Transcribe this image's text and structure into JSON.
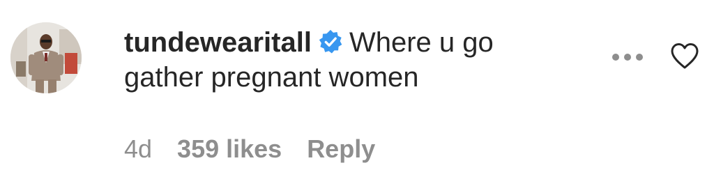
{
  "comment": {
    "username": "tundewearitall",
    "verified": true,
    "text_line1": "Where u go",
    "text_line2": "gather pregnant women",
    "time_ago": "4d",
    "likes": "359 likes",
    "reply_label": "Reply"
  },
  "icons": {
    "verified": "verified-badge-icon",
    "more": "more-options-icon",
    "like": "heart-outline-icon"
  },
  "colors": {
    "text": "#262626",
    "muted": "#8e8e8e",
    "verified_blue": "#3897f0"
  }
}
